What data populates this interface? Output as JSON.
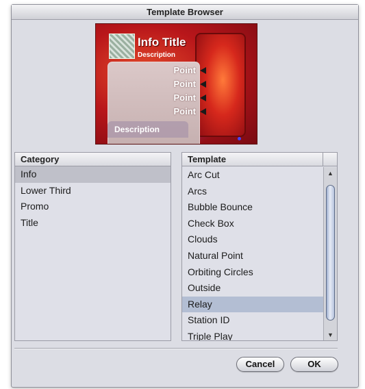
{
  "window": {
    "title": "Template Browser"
  },
  "preview": {
    "title": "Info Title",
    "description_top": "Description",
    "points": [
      "Point",
      "Point",
      "Point",
      "Point"
    ],
    "description_bottom": "Description"
  },
  "category_list": {
    "header": "Category",
    "items": [
      "Info",
      "Lower Third",
      "Promo",
      "Title"
    ],
    "selected": "Info"
  },
  "template_list": {
    "header": "Template",
    "items": [
      "Arc Cut",
      "Arcs",
      "Bubble Bounce",
      "Check Box",
      "Clouds",
      "Natural Point",
      "Orbiting Circles",
      "Outside",
      "Relay",
      "Station ID",
      "Triple Play"
    ],
    "selected": "Relay"
  },
  "scrollbar": {
    "up_icon": "triangle-up-icon",
    "down_icon": "triangle-down-icon"
  },
  "buttons": {
    "cancel": "Cancel",
    "ok": "OK"
  }
}
